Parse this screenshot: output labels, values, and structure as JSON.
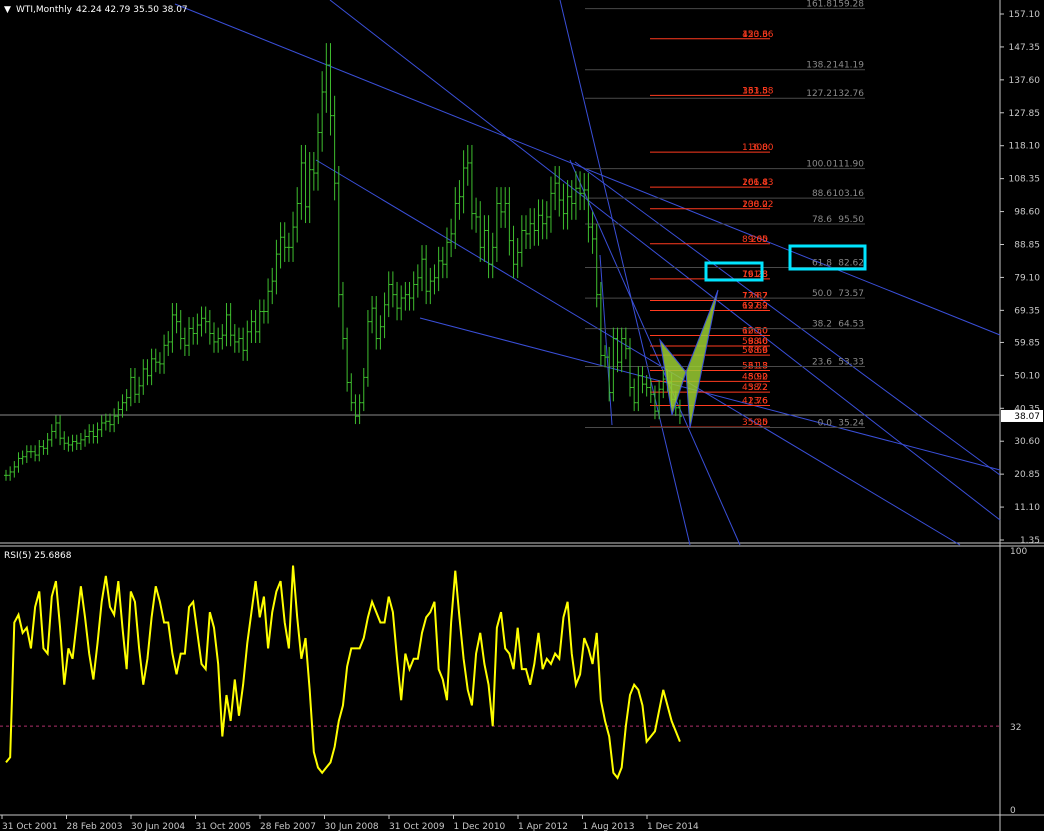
{
  "header": {
    "arrow": "▼",
    "symbol": "WTI,Monthly",
    "ohlc": "42.24 42.79 35.50 38.07"
  },
  "rsi_header": "RSI(5) 25.6868",
  "colors": {
    "background": "#000000",
    "candles": "#3fbf2f",
    "trendlines": "#3a4fd8",
    "fib_primary": "#ff3b1f",
    "fib_secondary": "#8a8a8a",
    "pattern_fill": "#9acd32",
    "highlight_box": "#00e5ff",
    "rsi_line": "#ffff00",
    "rsi_level": "#b0306a",
    "price_marker_bg": "#ffffff"
  },
  "chart_data": [
    {
      "type": "candlestick",
      "title": "WTI,Monthly",
      "ylim": [
        1.35,
        160
      ],
      "price_ticks": [
        "157.10",
        "147.35",
        "137.60",
        "127.85",
        "118.10",
        "108.35",
        "98.60",
        "88.85",
        "79.10",
        "69.35",
        "59.85",
        "50.10",
        "40.35",
        "30.60",
        "20.85",
        "11.10",
        "1.35"
      ],
      "current_price": "38.07",
      "date_ticks": [
        "31 Oct 2001",
        "28 Feb 2003",
        "30 Jun 2004",
        "31 Oct 2005",
        "28 Feb 2007",
        "30 Jun 2008",
        "31 Oct 2009",
        "1 Dec 2010",
        "1 Apr 2012",
        "1 Aug 2013",
        "1 Dec 2014"
      ],
      "closes": [
        20.5,
        21.5,
        23,
        25.5,
        26,
        27.5,
        27.5,
        26.5,
        29,
        28.5,
        31,
        33.5,
        36,
        31.5,
        30,
        29.5,
        30.5,
        30,
        31,
        32,
        33.5,
        32,
        34,
        36,
        36.5,
        35.5,
        38,
        40,
        42,
        43.5,
        49.5,
        44.5,
        47,
        52,
        50,
        55,
        54,
        53.5,
        59,
        60,
        68,
        66,
        61,
        59,
        64,
        62.5,
        65,
        67,
        66,
        62.5,
        60,
        61,
        62,
        68,
        62,
        60,
        61,
        57.5,
        63,
        66,
        63,
        69,
        69,
        75,
        78,
        86,
        91,
        88,
        88,
        94,
        101,
        113,
        100,
        111,
        110,
        122,
        134,
        142,
        127,
        107,
        74,
        61,
        48,
        42,
        38,
        42,
        49.5,
        66,
        70,
        61,
        64.5,
        71,
        77,
        74,
        70,
        73,
        74,
        73,
        77,
        79,
        84.5,
        75,
        78,
        79,
        84,
        83,
        89.5,
        92,
        101,
        103,
        111.5,
        113,
        98,
        97,
        88,
        93,
        83,
        88,
        101,
        98.5,
        101,
        90,
        83,
        86.5,
        93,
        92,
        95,
        93,
        97.5,
        95,
        97,
        104,
        107,
        102,
        98,
        103,
        101,
        105.5,
        104,
        105,
        94,
        90.5,
        74,
        56,
        55.5,
        45,
        61,
        54,
        61,
        58,
        46.5,
        42,
        50,
        47.5,
        46.5,
        44.5,
        39.5,
        46,
        49,
        48,
        43,
        40.5,
        38
      ]
    },
    {
      "type": "line",
      "title": "RSI(5) 25.6868",
      "ylim": [
        0,
        100
      ],
      "level": 32,
      "ticks": [
        "100",
        "32",
        "0"
      ],
      "values": [
        18,
        20,
        72,
        75,
        68,
        70,
        62,
        78,
        84,
        62,
        60,
        82,
        88,
        70,
        48,
        62,
        58,
        72,
        86,
        74,
        60,
        50,
        64,
        80,
        90,
        78,
        75,
        88,
        70,
        54,
        84,
        80,
        62,
        48,
        58,
        74,
        86,
        80,
        72,
        72,
        60,
        52,
        60,
        60,
        78,
        80,
        68,
        56,
        54,
        76,
        70,
        56,
        28,
        44,
        34,
        50,
        36,
        48,
        64,
        76,
        88,
        74,
        82,
        62,
        76,
        84,
        88,
        72,
        62,
        94,
        74,
        58,
        66,
        46,
        22,
        16,
        14,
        16,
        18,
        24,
        34,
        40,
        55,
        62,
        62,
        62,
        66,
        74,
        80,
        76,
        72,
        72,
        82,
        76,
        58,
        42,
        60,
        54,
        58,
        58,
        68,
        74,
        76,
        80,
        54,
        50,
        42,
        72,
        92,
        74,
        58,
        46,
        40,
        60,
        68,
        56,
        48,
        32,
        70,
        76,
        62,
        60,
        54,
        70,
        54,
        54,
        48,
        56,
        68,
        54,
        58,
        56,
        60,
        58,
        74,
        80,
        60,
        48,
        52,
        66,
        62,
        56,
        68,
        42,
        34,
        28,
        14,
        12,
        16,
        32,
        44,
        48,
        46,
        40,
        26,
        28,
        30,
        38,
        46,
        40,
        34,
        30,
        26
      ]
    }
  ],
  "fib_primary": [
    {
      "level": "423.6",
      "price": "150.36"
    },
    {
      "level": "361.8",
      "price": "133.58"
    },
    {
      "level": "300",
      "price": "116.80"
    },
    {
      "level": "261.8",
      "price": "106.43"
    },
    {
      "level": "238.2",
      "price": "100.02"
    },
    {
      "level": "200",
      "price": "89.65"
    },
    {
      "level": "161.8",
      "price": "79.28"
    },
    {
      "level": "138.2",
      "price": "72.87"
    },
    {
      "level": "127.2",
      "price": "69.89"
    },
    {
      "level": "100.0",
      "price": "62.50"
    },
    {
      "level": "88.6",
      "price": "59.40"
    },
    {
      "level": "78.6",
      "price": "56.69"
    },
    {
      "level": "61.8",
      "price": "52.13"
    },
    {
      "level": "50.0",
      "price": "48.92"
    },
    {
      "level": "38.2",
      "price": "45.72"
    },
    {
      "level": "23.6",
      "price": "41.76"
    },
    {
      "level": "0.0",
      "price": "35.35"
    }
  ],
  "fib_secondary": [
    {
      "level": "161.8",
      "price": "159.28"
    },
    {
      "level": "138.2",
      "price": "141.19"
    },
    {
      "level": "127.2",
      "price": "132.76"
    },
    {
      "level": "100.0",
      "price": "111.90"
    },
    {
      "level": "88.6",
      "price": "103.16"
    },
    {
      "level": "78.6",
      "price": "95.50"
    },
    {
      "level": "61.8",
      "price": "82.62"
    },
    {
      "level": "50.0",
      "price": "73.57"
    },
    {
      "level": "38.2",
      "price": "64.53"
    },
    {
      "level": "23.6",
      "price": "53.33"
    },
    {
      "level": "0.0",
      "price": "35.24"
    }
  ]
}
